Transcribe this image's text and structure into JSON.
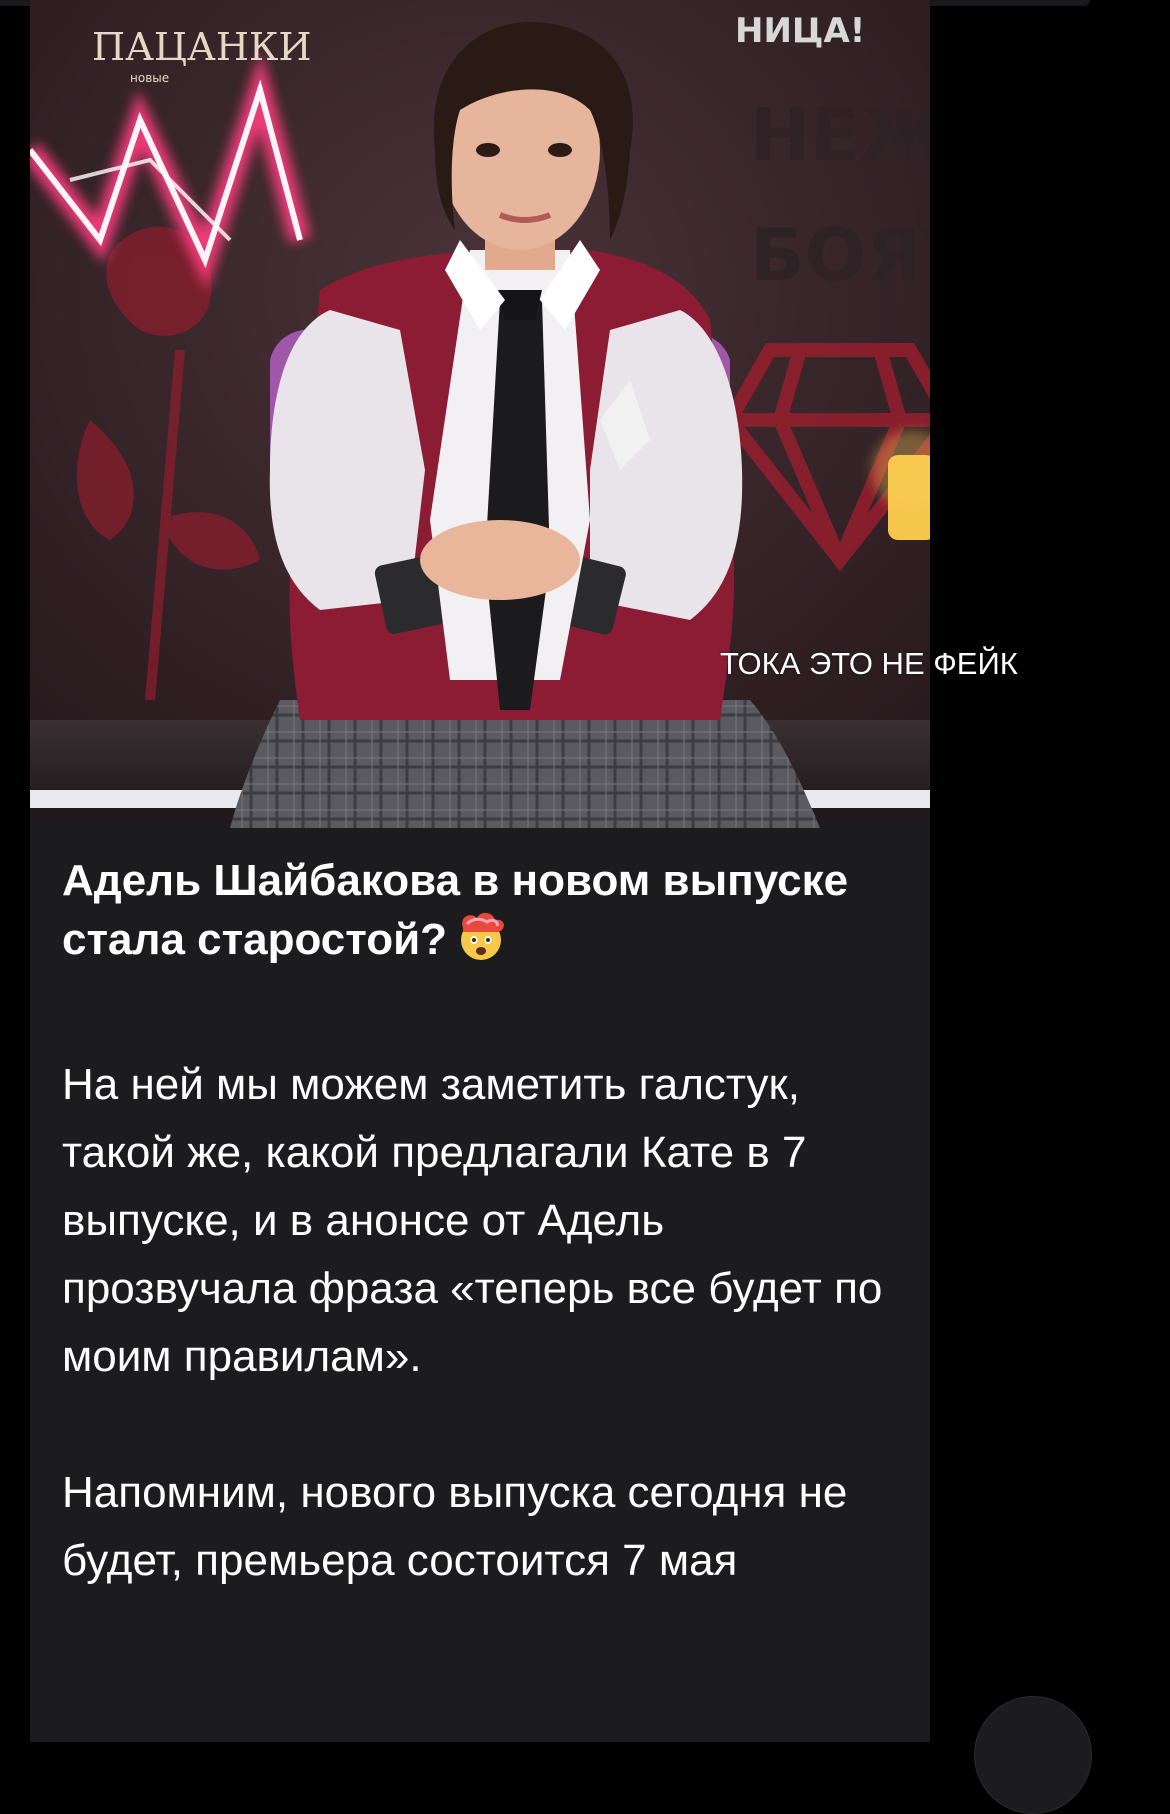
{
  "post": {
    "image_alt": "Person in maroon varsity jacket with white shirt and black tie seated on a stage",
    "title": "Адель Шайбакова в новом выпуске стала старостой?",
    "title_emoji": "exploding-head-emoji",
    "paragraph_1": "На ней мы можем заметить галстук, такой же, какой предлагали Кате в 7 выпуске, и в анонсе от Адель прозвучала фраза «теперь все будет по моим правилам».",
    "paragraph_2": "Напомним, нового выпуска сегодня не будет, премьера состоится 7 мая"
  },
  "overlay": {
    "caption": "ТОКА ЭТО НЕ ФЕЙК"
  },
  "image_signage": {
    "logo_text": "ПАЦАНКИ",
    "logo_sub": "новые",
    "banner_text": "НИЦА!",
    "wall_text_1": "НЕЖ",
    "wall_text_2": "БОЯТ"
  },
  "colors": {
    "background": "#000000",
    "card": "#1c1c1e",
    "text": "#ffffff",
    "jacket": "#8c1c33",
    "neon": "#ff3d7f"
  }
}
